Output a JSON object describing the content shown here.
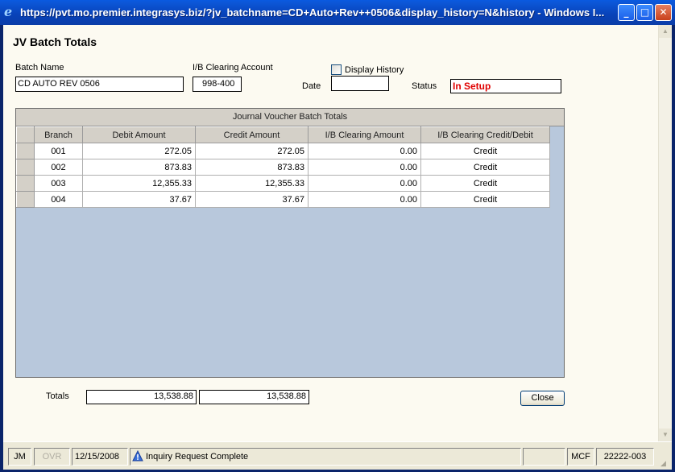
{
  "window": {
    "title": "https://pvt.mo.premier.integrasys.biz/?jv_batchname=CD+Auto+Rev++0506&display_history=N&history - Windows I...",
    "minimize_label": "_",
    "maximize_label": "□",
    "close_label": "✕"
  },
  "page": {
    "heading": "JV Batch Totals"
  },
  "form": {
    "batch_name_label": "Batch Name",
    "batch_name_value": "CD AUTO REV  0506",
    "ib_clearing_label": "I/B Clearing Account",
    "ib_clearing_value": "998-400",
    "display_history_label": "Display History",
    "display_history_checked": false,
    "date_label": "Date",
    "date_value": "",
    "status_label": "Status",
    "status_value": "In Setup",
    "status_color": "#e00000"
  },
  "grid": {
    "caption": "Journal Voucher Batch Totals",
    "columns": [
      "Branch",
      "Debit Amount",
      "Credit Amount",
      "I/B Clearing Amount",
      "I/B Clearing Credit/Debit"
    ],
    "rows": [
      {
        "branch": "001",
        "debit": "272.05",
        "credit": "272.05",
        "ib_amount": "0.00",
        "ib_cd": "Credit"
      },
      {
        "branch": "002",
        "debit": "873.83",
        "credit": "873.83",
        "ib_amount": "0.00",
        "ib_cd": "Credit"
      },
      {
        "branch": "003",
        "debit": "12,355.33",
        "credit": "12,355.33",
        "ib_amount": "0.00",
        "ib_cd": "Credit"
      },
      {
        "branch": "004",
        "debit": "37.67",
        "credit": "37.67",
        "ib_amount": "0.00",
        "ib_cd": "Credit"
      }
    ],
    "background_color": "#b8c8dc"
  },
  "totals": {
    "label": "Totals",
    "debit_total": "13,538.88",
    "credit_total": "13,538.88"
  },
  "buttons": {
    "close_label": "Close"
  },
  "statusbar": {
    "user": "JM",
    "ovr": "OVR",
    "date": "12/15/2008",
    "message": "Inquiry Request Complete",
    "message_icon": "info-icon",
    "empty": "",
    "system": "MCF",
    "code": "22222-003"
  }
}
